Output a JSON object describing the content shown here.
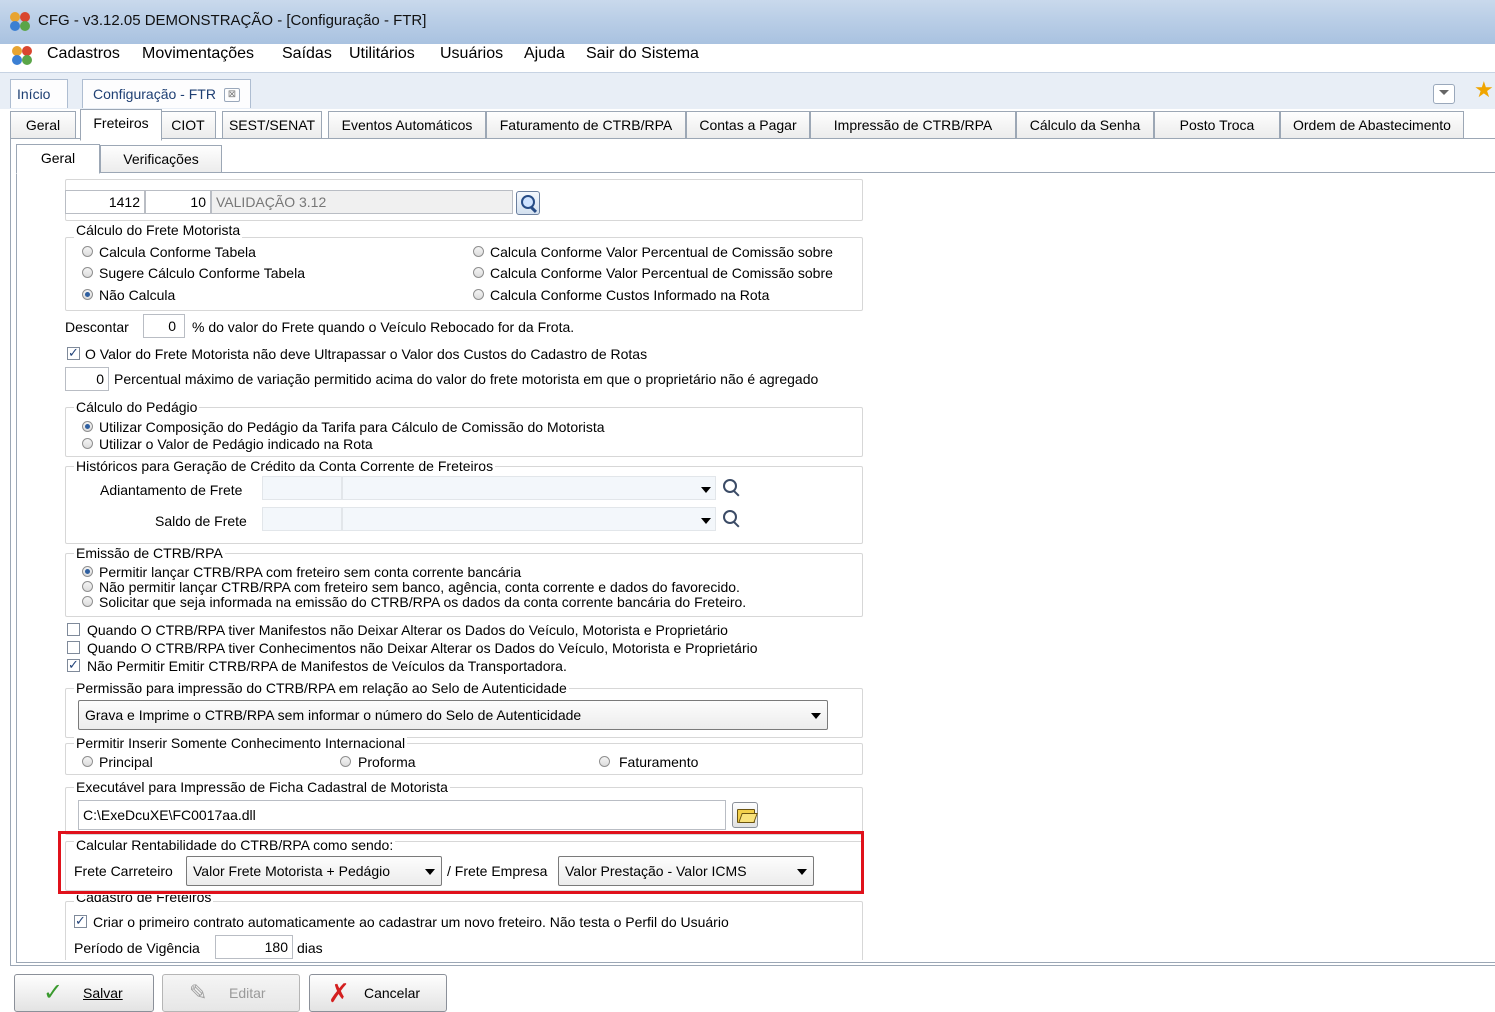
{
  "window": {
    "title": "CFG - v3.12.05   DEMONSTRAÇÃO - [Configuração - FTR]"
  },
  "menu": {
    "items": [
      {
        "label": "Cadastros"
      },
      {
        "label": "Movimentações"
      },
      {
        "label": "Saídas"
      },
      {
        "label": "Utilitários"
      },
      {
        "label": "Usuários"
      },
      {
        "label": "Ajuda"
      },
      {
        "label": "Sair do Sistema"
      }
    ]
  },
  "doc_tabs": {
    "home": "Início",
    "current": "Configuração - FTR",
    "close": "⊠"
  },
  "main_tabs": [
    "Geral",
    "Freteiros",
    "CIOT",
    "SEST/SENAT",
    "Eventos Automáticos",
    "Faturamento de CTRB/RPA",
    "Contas a Pagar",
    "Impressão de CTRB/RPA",
    "Cálculo da Senha",
    "Posto Troca",
    "Ordem de Abastecimento"
  ],
  "sub_tabs": [
    "Geral",
    "Verificações"
  ],
  "cdc": {
    "code": "1412",
    "sub": "10",
    "desc": "VALIDAÇÃO 3.12"
  },
  "calc_frete": {
    "title": "Cálculo do Frete Motorista",
    "opt1": "Calcula Conforme Tabela",
    "opt2": "Sugere Cálculo Conforme Tabela",
    "opt3": "Não Calcula",
    "opt4": "Calcula Conforme Valor Percentual de Comissão sobre",
    "opt5": "Calcula Conforme Valor Percentual de Comissão sobre",
    "opt6": "Calcula Conforme Custos Informado na Rota"
  },
  "desconto": {
    "prefix": "Descontar",
    "value": "0",
    "suffix": "%  do valor do Frete quando o Veículo Rebocado for da Frota."
  },
  "valor_frete_check": "O Valor do Frete Motorista não deve Ultrapassar o Valor dos Custos do Cadastro de Rotas",
  "percentual": {
    "value": "0",
    "label": "Percentual máximo de variação permitido acima do valor do frete motorista em que o proprietário não é agregado"
  },
  "pedagio": {
    "title": "Cálculo do Pedágio",
    "opt1": "Utilizar Composição do Pedágio da Tarifa para Cálculo de Comissão do Motorista",
    "opt2": "Utilizar o Valor de Pedágio indicado na Rota"
  },
  "historicos": {
    "title": "Históricos para Geração de Crédito da Conta Corrente de Freteiros",
    "adiantamento": "Adiantamento de Frete",
    "saldo": "Saldo de Frete"
  },
  "emissao": {
    "title": "Emissão de CTRB/RPA",
    "opt1": "Permitir lançar CTRB/RPA com freteiro sem conta corrente bancária",
    "opt2": "Não permitir lançar CTRB/RPA com freteiro sem banco, agência, conta corrente e dados do favorecido.",
    "opt3": "Solicitar que seja informada na emissão do CTRB/RPA os dados da conta corrente bancária do Freteiro."
  },
  "checks": {
    "c1": "Quando O CTRB/RPA tiver Manifestos não Deixar Alterar os Dados do Veículo, Motorista e Proprietário",
    "c2": "Quando O CTRB/RPA tiver Conhecimentos não Deixar Alterar os Dados do Veículo, Motorista e Proprietário",
    "c3": "Não Permitir Emitir CTRB/RPA de Manifestos de Veículos da Transportadora."
  },
  "selo": {
    "title": "Permissão para impressão do CTRB/RPA em relação ao Selo de Autenticidade",
    "value": "Grava e Imprime o CTRB/RPA sem informar o número do Selo de Autenticidade"
  },
  "internacional": {
    "title": "Permitir Inserir Somente Conhecimento Internacional",
    "opt1": "Principal",
    "opt2": "Proforma",
    "opt3": "Faturamento"
  },
  "executavel": {
    "title": "Executável para Impressão de Ficha Cadastral de Motorista",
    "value": "C:\\ExeDcuXE\\FC0017aa.dll"
  },
  "rentabilidade": {
    "title": "Calcular Rentabilidade do CTRB/RPA como sendo:",
    "carreteiro_label": "Frete Carreteiro",
    "carreteiro_value": "Valor Frete Motorista + Pedágio",
    "empresa_label": "/ Frete Empresa",
    "empresa_value": "Valor Prestação - Valor ICMS"
  },
  "cadastro": {
    "title": "Cadastro de Freteiros",
    "check": "Criar o primeiro contrato automaticamente ao cadastrar um novo freteiro. Não testa o Perfil do Usuário",
    "vigencia_label": "Período de Vigência",
    "vigencia_value": "180",
    "vigencia_unit": "dias"
  },
  "buttons": {
    "save": "Salvar",
    "edit": "Editar",
    "cancel": "Cancelar"
  },
  "colors": {
    "highlight": "#e0111b",
    "titlebar": "#b8cde6",
    "accent": "#1e3f73"
  }
}
